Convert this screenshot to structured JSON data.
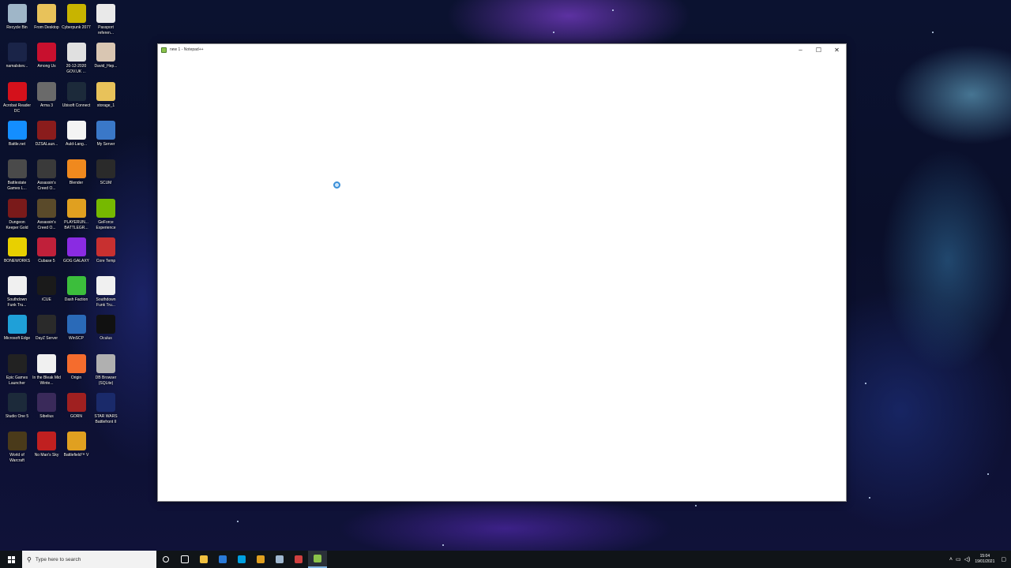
{
  "desktop": {
    "icons": [
      {
        "label": "Recycle Bin",
        "icon": "recycle-bin-icon",
        "color": "#9fb6c8"
      },
      {
        "label": "From Desktop",
        "icon": "folder-icon",
        "color": "#e8c25a"
      },
      {
        "label": "Cyberpunk 2077",
        "icon": "cyberpunk-icon",
        "color": "#c8b400"
      },
      {
        "label": "Passport referen...",
        "icon": "document-icon",
        "color": "#e9e9e9"
      },
      {
        "label": "namalskev...",
        "icon": "blank-icon",
        "color": "#1a2448"
      },
      {
        "label": "Among Us",
        "icon": "among-us-icon",
        "color": "#c8102e"
      },
      {
        "label": "20-12-2020 GOV.UK ...",
        "icon": "pdf-icon",
        "color": "#e0e0e0"
      },
      {
        "label": "David_Hep...",
        "icon": "photo-icon",
        "color": "#d9c6b2"
      },
      {
        "label": "Acrobat Reader DC",
        "icon": "acrobat-icon",
        "color": "#d4111b"
      },
      {
        "label": "Arma 3",
        "icon": "arma-icon",
        "color": "#6a6a6a"
      },
      {
        "label": "Ubisoft Connect",
        "icon": "ubisoft-icon",
        "color": "#1c2a3a"
      },
      {
        "label": "storage_1",
        "icon": "folder-icon",
        "color": "#e8c25a"
      },
      {
        "label": "Battle.net",
        "icon": "battlenet-icon",
        "color": "#148eff"
      },
      {
        "label": "DZSALaun...",
        "icon": "dzsa-icon",
        "color": "#8a1c1c"
      },
      {
        "label": "Auld-Lang...",
        "icon": "text-file-icon",
        "color": "#f4f4f4"
      },
      {
        "label": "My Server",
        "icon": "server-icon",
        "color": "#3a78c8"
      },
      {
        "label": "Battlestate Games L...",
        "icon": "battlestate-icon",
        "color": "#4a4a4a"
      },
      {
        "label": "Assassin's Creed O...",
        "icon": "assassins-creed-icon",
        "color": "#3a3a3a"
      },
      {
        "label": "Blender",
        "icon": "blender-icon",
        "color": "#f0891e"
      },
      {
        "label": "SCUM",
        "icon": "scum-icon",
        "color": "#2a2a2a"
      },
      {
        "label": "Dungeon Keeper Gold",
        "icon": "dungeon-keeper-icon",
        "color": "#7a1a1a"
      },
      {
        "label": "Assassin's Creed O...",
        "icon": "assassins-creed-icon",
        "color": "#5a4a2a"
      },
      {
        "label": "PLAYERUN... BATTLEGR...",
        "icon": "pubg-icon",
        "color": "#e0a020"
      },
      {
        "label": "GeForce Experience",
        "icon": "geforce-icon",
        "color": "#76b900"
      },
      {
        "label": "BONEWORKS",
        "icon": "boneworks-icon",
        "color": "#e8d000"
      },
      {
        "label": "Cubase 5",
        "icon": "cubase-icon",
        "color": "#c0203a"
      },
      {
        "label": "GOG GALAXY",
        "icon": "gog-icon",
        "color": "#8a2be2"
      },
      {
        "label": "Core Temp",
        "icon": "core-temp-icon",
        "color": "#c83030"
      },
      {
        "label": "Southdown Funk Tru...",
        "icon": "audio-file-icon",
        "color": "#f0f0f0"
      },
      {
        "label": "iCUE",
        "icon": "icue-icon",
        "color": "#1a1a1a"
      },
      {
        "label": "Dash Faction",
        "icon": "dash-faction-icon",
        "color": "#3cbe3c"
      },
      {
        "label": "Southdown Funk Tru...",
        "icon": "audio-file-icon",
        "color": "#f0f0f0"
      },
      {
        "label": "Microsoft Edge",
        "icon": "edge-icon",
        "color": "#1fa0d8"
      },
      {
        "label": "DayZ Server",
        "icon": "dayz-icon",
        "color": "#2a2a2a"
      },
      {
        "label": "WinSCP",
        "icon": "winscp-icon",
        "color": "#2a6ab8"
      },
      {
        "label": "Oculus",
        "icon": "oculus-icon",
        "color": "#111111"
      },
      {
        "label": "Epic Games Launcher",
        "icon": "epic-games-icon",
        "color": "#222222"
      },
      {
        "label": "In the Bleak Mid Winte...",
        "icon": "audio-file-icon",
        "color": "#f0f0f0"
      },
      {
        "label": "Origin",
        "icon": "origin-icon",
        "color": "#f56c2d"
      },
      {
        "label": "DB Browser (SQLite)",
        "icon": "db-browser-icon",
        "color": "#b0b0b0"
      },
      {
        "label": "Studio One 5",
        "icon": "studio-one-icon",
        "color": "#1c2a3a"
      },
      {
        "label": "Sibelius",
        "icon": "sibelius-icon",
        "color": "#3a2a5a"
      },
      {
        "label": "GORN",
        "icon": "gorn-icon",
        "color": "#a02020"
      },
      {
        "label": "STAR WARS Battlefront II",
        "icon": "star-wars-icon",
        "color": "#1a2a6a"
      },
      {
        "label": "World of Warcraft",
        "icon": "wow-icon",
        "color": "#4a3a1a"
      },
      {
        "label": "No Man's Sky",
        "icon": "no-mans-sky-icon",
        "color": "#c02020"
      },
      {
        "label": "Battlefield™ V",
        "icon": "battlefield-icon",
        "color": "#e0a020"
      }
    ]
  },
  "window": {
    "title": "new 1 - Notepad++",
    "minimize": "–",
    "maximize": "☐",
    "close": "✕"
  },
  "taskbar": {
    "search_placeholder": "Type here to search",
    "pinned": [
      {
        "name": "cortana-icon",
        "color": "#ffffff"
      },
      {
        "name": "task-view-icon",
        "color": "#ffffff"
      },
      {
        "name": "file-explorer-icon",
        "color": "#f0c040"
      },
      {
        "name": "mail-icon",
        "color": "#2a7ad8"
      },
      {
        "name": "skype-icon",
        "color": "#00a0e0"
      },
      {
        "name": "chrome-icon",
        "color": "#e0a020"
      },
      {
        "name": "steam-icon",
        "color": "#a0b8d0"
      },
      {
        "name": "snipping-tool-icon",
        "color": "#d04040"
      },
      {
        "name": "notepad-plus-plus-icon",
        "color": "#8bc34a"
      }
    ],
    "time": "15:04",
    "date": "19/01/2021"
  }
}
